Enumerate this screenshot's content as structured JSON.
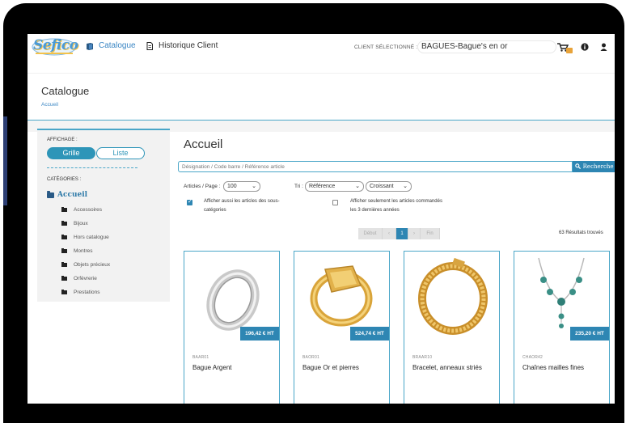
{
  "app": {
    "logo_text": "Sefico"
  },
  "nav": {
    "catalogue": "Catalogue",
    "historique": "Historique Client"
  },
  "client": {
    "label": "CLIENT SÉLECTIONNÉ :",
    "value": "BAGUES-Bague's en or"
  },
  "topbar_icons": [
    "cart-icon",
    "info-icon",
    "user-icon"
  ],
  "header": {
    "title": "Catalogue",
    "breadcrumb": "Accueil"
  },
  "sidebar": {
    "display_label": "AFFICHAGE :",
    "grid_label": "Grille",
    "list_label": "Liste",
    "categories_label": "CATÉGORIES :",
    "root_category": "Accueil",
    "categories": [
      "Accessoires",
      "Bijoux",
      "Hors catalogue",
      "Montres",
      "Objets précieux",
      "Orfèvrerie",
      "Prestations"
    ]
  },
  "main": {
    "title": "Accueil",
    "search_placeholder": "Désignation / Code barre / Référence article",
    "search_button": "Recherche",
    "per_page_label": "Articles / Page :",
    "per_page_value": "100",
    "sort_label": "Tri :",
    "sort_field": "Référence",
    "sort_order": "Croissant",
    "checkbox_subcategories": "Afficher aussi les articles des sous-catégories",
    "checkbox_subcategories_checked": true,
    "checkbox_recent": "Afficher seulement les articles commandés les 3 dernières années",
    "checkbox_recent_checked": false,
    "pagination": {
      "first": "Début",
      "prev": "‹",
      "current": "1",
      "next": "›",
      "last": "Fin"
    },
    "results_count": "63 Résultats trouvés"
  },
  "products": [
    {
      "ref": "BAAR01",
      "name": "Bague Argent",
      "price": "196,42 € HT",
      "image": "silver-ring"
    },
    {
      "ref": "BAOR01",
      "name": "Bague Or et pierres",
      "price": "524,74 € HT",
      "image": "gold-signet-ring"
    },
    {
      "ref": "BRAAR10",
      "name": "Bracelet, anneaux striés",
      "price": "",
      "image": "gold-chain-bracelet"
    },
    {
      "ref": "CHAOR42",
      "name": "Chaînes mailles fines",
      "price": "235,20 € HT",
      "image": "turquoise-necklace"
    }
  ],
  "colors": {
    "accent": "#2e86b3",
    "link": "#3a86c4",
    "border": "#4aa6c8"
  }
}
